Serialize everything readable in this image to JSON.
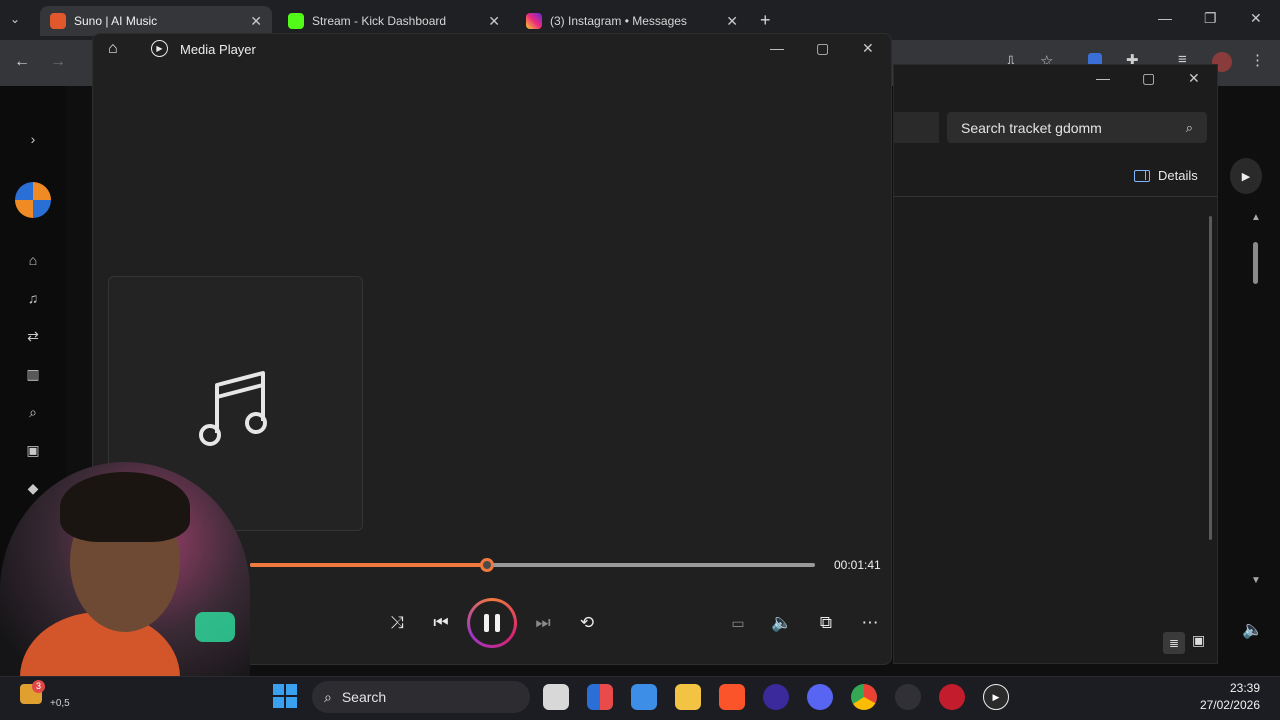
{
  "browser": {
    "tabs": [
      {
        "label": "Suno | AI Music",
        "favicon_color": "#e2582d"
      },
      {
        "label": "Stream - Kick Dashboard",
        "favicon_color": "#53fc18"
      },
      {
        "label": "(3) Instagram • Messages",
        "favicon_color": "#d6249f"
      }
    ],
    "new_tab_symbol": "+",
    "close_symbol": "✕"
  },
  "explorer": {
    "search_placeholder": "Search tracket gdomm",
    "details_label": "Details"
  },
  "player": {
    "title": "Media Player",
    "time_label": "00:01:41",
    "progress": 0.42,
    "accent_color": "#f07a3d"
  },
  "taskbar": {
    "search_label": "Search",
    "time": "23:39",
    "date": "27/02/2026",
    "widget_badge": "3",
    "weather": "+0,5"
  }
}
